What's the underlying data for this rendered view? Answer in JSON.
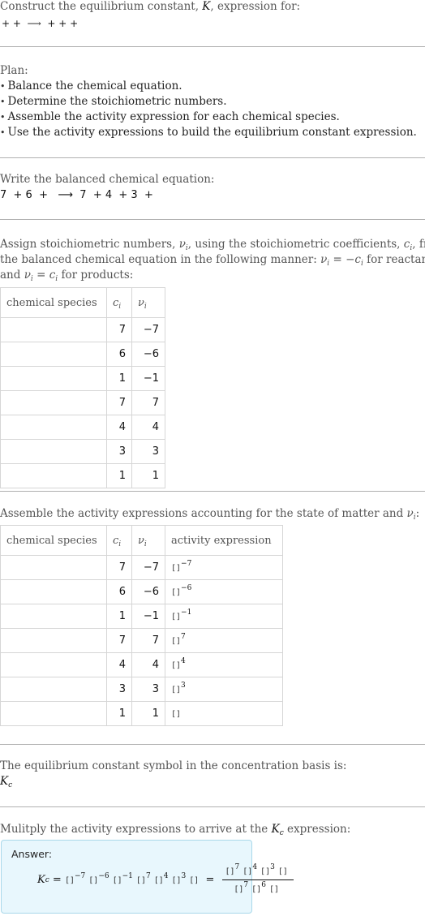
{
  "header": {
    "prompt": "Construct the equilibrium constant, K, expression for:",
    "prompt_parts": [
      "Construct the equilibrium constant, ",
      "K",
      ", expression for:"
    ],
    "unbalanced_equation": "+ +  ⟶  + + +"
  },
  "plan": {
    "title": "Plan:",
    "steps": [
      "Balance the chemical equation.",
      "Determine the stoichiometric numbers.",
      "Assemble the activity expression for each chemical species.",
      "Use the activity expressions to build the equilibrium constant expression."
    ]
  },
  "balanced": {
    "title": "Write the balanced chemical equation:",
    "equation": "7  + 6  +   ⟶  7  + 4  + 3  +"
  },
  "stoich": {
    "intro_line1": "Assign stoichiometric numbers, ",
    "nu_i": "ν",
    "sub_i": "i",
    "intro_line1b": ", using the stoichiometric coefficients, ",
    "c_i": "c",
    "intro_line1c": ", from",
    "intro_line2a": "the balanced chemical equation in the following manner: ",
    "intro_line2b": " = −",
    "intro_line2c": " for reactants",
    "intro_line3a": "and ",
    "intro_line3b": " = ",
    "intro_line3c": " for products:",
    "table": {
      "headers": [
        "chemical species",
        "c",
        "ν"
      ],
      "rows": [
        {
          "species": "",
          "c": "7",
          "nu": "−7"
        },
        {
          "species": "",
          "c": "6",
          "nu": "−6"
        },
        {
          "species": "",
          "c": "1",
          "nu": "−1"
        },
        {
          "species": "",
          "c": "7",
          "nu": "7"
        },
        {
          "species": "",
          "c": "4",
          "nu": "4"
        },
        {
          "species": "",
          "c": "3",
          "nu": "3"
        },
        {
          "species": "",
          "c": "1",
          "nu": "1"
        }
      ]
    }
  },
  "activity": {
    "intro": "Assemble the activity expressions accounting for the state of matter and ",
    "intro_end": ":",
    "table": {
      "headers": [
        "chemical species",
        "c",
        "ν",
        "activity expression"
      ],
      "rows": [
        {
          "species": "",
          "c": "7",
          "nu": "−7",
          "base": "[]",
          "exp": "−7"
        },
        {
          "species": "",
          "c": "6",
          "nu": "−6",
          "base": "[]",
          "exp": "−6"
        },
        {
          "species": "",
          "c": "1",
          "nu": "−1",
          "base": "[]",
          "exp": "−1"
        },
        {
          "species": "",
          "c": "7",
          "nu": "7",
          "base": "[]",
          "exp": "7"
        },
        {
          "species": "",
          "c": "4",
          "nu": "4",
          "base": "[]",
          "exp": "4"
        },
        {
          "species": "",
          "c": "3",
          "nu": "3",
          "base": "[]",
          "exp": "3"
        },
        {
          "species": "",
          "c": "1",
          "nu": "1",
          "base": "[]",
          "exp": ""
        }
      ]
    }
  },
  "symbol": {
    "intro": "The equilibrium constant symbol in the concentration basis is:",
    "K": "K",
    "sub": "c"
  },
  "multiply": {
    "intro_a": "Mulitply the activity expressions to arrive at the ",
    "intro_b": " expression:",
    "K": "K",
    "sub": "c"
  },
  "answer": {
    "label": "Answer:",
    "K": "K",
    "sub": "c",
    "equals": " = ",
    "product_terms": [
      {
        "base": "[]",
        "exp": "−7"
      },
      {
        "base": "[]",
        "exp": "−6"
      },
      {
        "base": "[]",
        "exp": "−1"
      },
      {
        "base": "[]",
        "exp": "7"
      },
      {
        "base": "[]",
        "exp": "4"
      },
      {
        "base": "[]",
        "exp": "3"
      },
      {
        "base": "[]",
        "exp": ""
      }
    ],
    "numerator_terms": [
      {
        "base": "[]",
        "exp": "7"
      },
      {
        "base": "[]",
        "exp": "4"
      },
      {
        "base": "[]",
        "exp": "3"
      },
      {
        "base": "[]",
        "exp": ""
      }
    ],
    "denominator_terms": [
      {
        "base": "[]",
        "exp": "7"
      },
      {
        "base": "[]",
        "exp": "6"
      },
      {
        "base": "[]",
        "exp": ""
      }
    ],
    "colors": {
      "background": "#e8f7fd",
      "border": "#a9d8ea"
    }
  }
}
